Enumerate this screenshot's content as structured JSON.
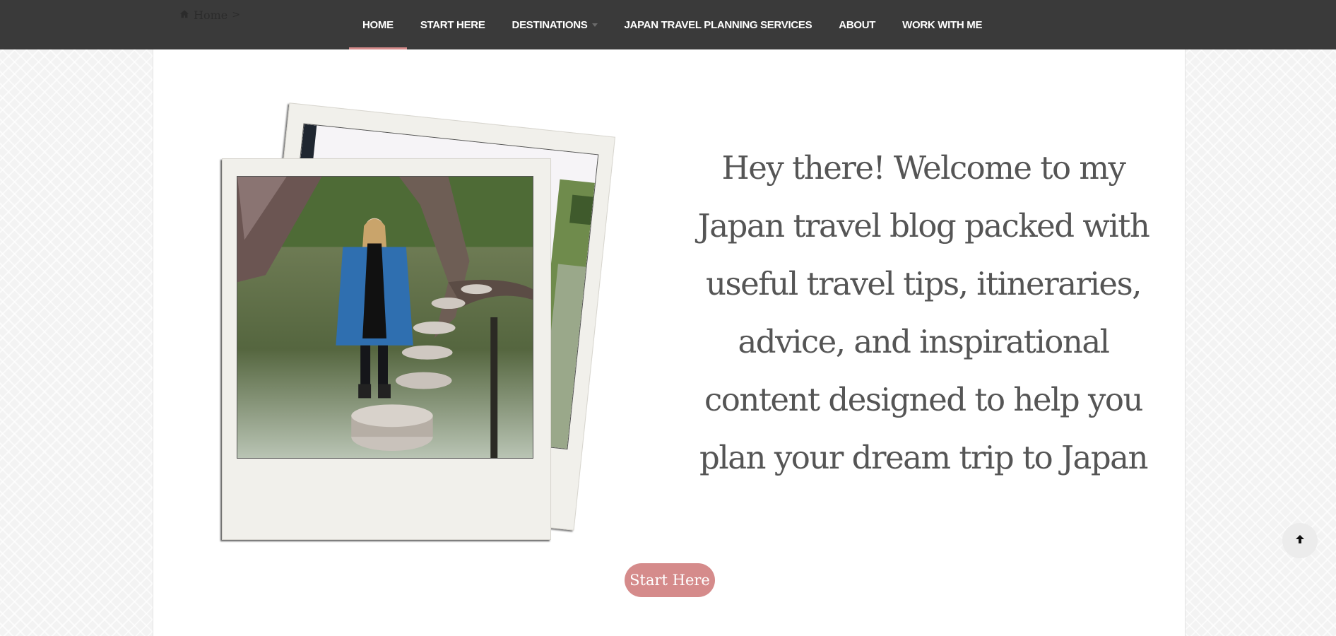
{
  "breadcrumb": {
    "home_label": "Home",
    "separator": ">"
  },
  "nav": {
    "items": [
      {
        "label": "HOME",
        "active": true
      },
      {
        "label": "START HERE"
      },
      {
        "label": "DESTINATIONS",
        "has_dropdown": true
      },
      {
        "label": "JAPAN TRAVEL PLANNING SERVICES"
      },
      {
        "label": "ABOUT"
      },
      {
        "label": "WORK WITH ME"
      }
    ]
  },
  "hero": {
    "lines": [
      "Hey there! Welcome to my",
      "Japan travel blog packed with",
      "useful travel tips, itineraries,",
      "advice, and inspirational",
      "content designed to help you",
      "plan your dream trip to Japan"
    ],
    "cta_label": "Start Here"
  },
  "icons": {
    "home": "home-icon",
    "scroll_top": "arrow-up-icon"
  },
  "colors": {
    "navbar": "#3a3a3a",
    "accent": "#d58b8b",
    "text": "#555555"
  }
}
